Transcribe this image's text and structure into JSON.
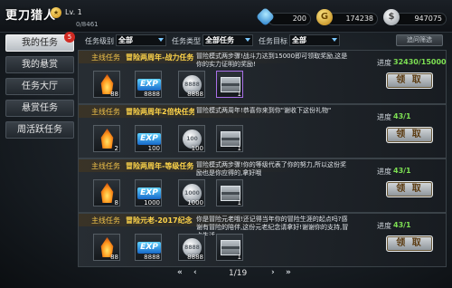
{
  "header": {
    "title": "更刀猎人",
    "level": "Lv. 1",
    "progress_count": "0/8461",
    "currencies": [
      {
        "icon": "gem-icon",
        "value": "200"
      },
      {
        "icon": "gold-icon",
        "value": "174238"
      },
      {
        "icon": "silver-icon",
        "value": "947075"
      }
    ]
  },
  "sidebar": {
    "items": [
      {
        "label": "我的任务",
        "badge": "5",
        "active": true
      },
      {
        "label": "我的悬赏"
      },
      {
        "label": "任务大厅"
      },
      {
        "label": "悬赏任务"
      },
      {
        "label": "周活跃任务"
      }
    ]
  },
  "filters": {
    "level_label": "任务级别",
    "level_value": "全部",
    "type_label": "任务类型",
    "type_value": "全部任务",
    "target_label": "任务目标",
    "target_value": "全部",
    "filter_button": "追问筛选"
  },
  "quests": [
    {
      "type": "主线任务",
      "name": "冒险两周年-战力任务",
      "desc": "冒险模式两步骤!战斗力达到15000即可领取奖励,这是你的实力证明的奖励!",
      "progress_label": "进度",
      "progress_value": "32430/15000",
      "claim_label": "领 取",
      "rewards": [
        {
          "icon": "flame-crystal-icon",
          "qty": "88"
        },
        {
          "icon": "exp-icon",
          "label": "EXP",
          "qty": "8888"
        },
        {
          "icon": "silver-coin-icon",
          "label": "8888",
          "qty": "8888"
        },
        {
          "icon": "treasure-chest-icon",
          "qty": "1"
        }
      ]
    },
    {
      "type": "主线任务",
      "name": "冒险两周年2倍快任务",
      "desc": "冒险模式两周年!恭喜你来到你\"谢收下这份礼物\"",
      "progress_label": "进度",
      "progress_value": "43/1",
      "claim_label": "领 取",
      "rewards": [
        {
          "icon": "flame-crystal-icon",
          "qty": "2"
        },
        {
          "icon": "exp-icon",
          "label": "EXP",
          "qty": "100"
        },
        {
          "icon": "silver-coin-icon",
          "label": "100",
          "qty": "100"
        },
        {
          "icon": "treasure-chest-icon",
          "qty": "1"
        }
      ]
    },
    {
      "type": "主线任务",
      "name": "冒险两周年-等级任务",
      "desc": "冒险模式两步骤!你的等级代表了你的努力,所以这份奖励也是你应得的,拿好哦",
      "progress_label": "进度",
      "progress_value": "43/1",
      "claim_label": "领 取",
      "rewards": [
        {
          "icon": "flame-crystal-icon",
          "qty": "8"
        },
        {
          "icon": "exp-icon",
          "label": "EXP",
          "qty": "1000"
        },
        {
          "icon": "silver-coin-icon",
          "label": "1000",
          "qty": "1000"
        },
        {
          "icon": "treasure-chest-icon",
          "qty": "1"
        }
      ]
    },
    {
      "type": "主线任务",
      "name": "冒险元老-2017纪念",
      "desc": "你是冒险元老哦!还记得当年你的冒险生涯的起点吗?感谢有冒险的陪伴,这份元老纪念请拿好!谢谢你的支持,冒点生活",
      "progress_label": "进度",
      "progress_value": "43/1",
      "claim_label": "领 取",
      "rewards": [
        {
          "icon": "flame-crystal-icon",
          "qty": "88"
        },
        {
          "icon": "exp-icon",
          "label": "EXP",
          "qty": "8888"
        },
        {
          "icon": "silver-coin-icon",
          "label": "8888",
          "qty": "8888"
        },
        {
          "icon": "treasure-chest-icon",
          "qty": "1"
        }
      ]
    }
  ],
  "pager": {
    "first": "«",
    "prev": "‹",
    "value": "1/19",
    "next": "›",
    "last": "»"
  }
}
